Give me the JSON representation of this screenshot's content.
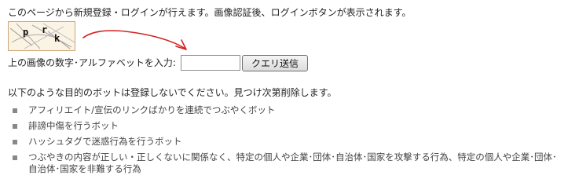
{
  "intro_text": "このページから新規登録・ログインが行えます。画像認証後、ログインボタンが表示されます。",
  "captcha": {
    "chars": [
      "p",
      "r",
      "k"
    ]
  },
  "captcha_form": {
    "label": "上の画像の数字･アルファベットを入力:",
    "input_value": "",
    "submit_label": "クエリ送信"
  },
  "notice_text": "以下のような目的のボットは登録しないでください。見つけ次第削除します。",
  "bot_rules": [
    "アフィリエイト/宣伝のリンクばかりを連続でつぶやくボット",
    "誹謗中傷を行うボット",
    "ハッシュタグで迷惑行為を行うボット",
    "つぶやきの内容が正しい・正しくないに関係なく、特定の個人や企業･団体･自治体･国家を攻撃する行為、特定の個人や企業･団体･自治体･国家を非難する行為"
  ],
  "colors": {
    "annotation_arrow": "#d62020",
    "captcha_border": "#c9a777"
  }
}
